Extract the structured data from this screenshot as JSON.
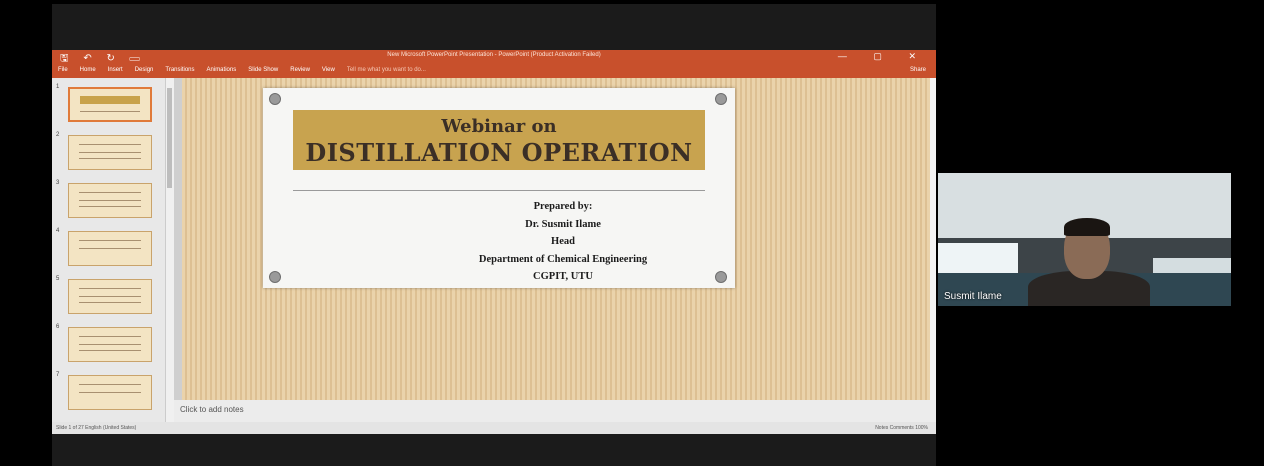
{
  "powerpoint": {
    "window_title": "New Microsoft PowerPoint Presentation - PowerPoint (Product Activation Failed)",
    "quick_access": [
      "🖫",
      "↶",
      "↻",
      "▭"
    ],
    "window_controls": [
      "—",
      "▢",
      "✕"
    ],
    "ribbon_tabs": [
      "File",
      "Home",
      "Insert",
      "Design",
      "Transitions",
      "Animations",
      "Slide Show",
      "Review",
      "View"
    ],
    "tell_me": "Tell me what you want to do...",
    "share": "Share",
    "notes_placeholder": "Click to add notes",
    "status_left": "Slide 1 of 27   English (United States)",
    "status_right": "Notes   Comments   100%",
    "thumbnail_numbers": [
      "1",
      "2",
      "3",
      "4",
      "5",
      "6",
      "7"
    ]
  },
  "slide": {
    "title_line1": "Webinar on",
    "title_line2": "DISTILLATION OPERATION",
    "credits": [
      "Prepared by:",
      "Dr. Susmit Ilame",
      "Head",
      "Department of Chemical Engineering",
      "CGPIT, UTU"
    ]
  },
  "video": {
    "participant_name": "Susmit Ilame"
  },
  "colors": {
    "ribbon": "#c8502c",
    "slide_band": "#c8a34f",
    "slide_text": "#3b2f26"
  }
}
